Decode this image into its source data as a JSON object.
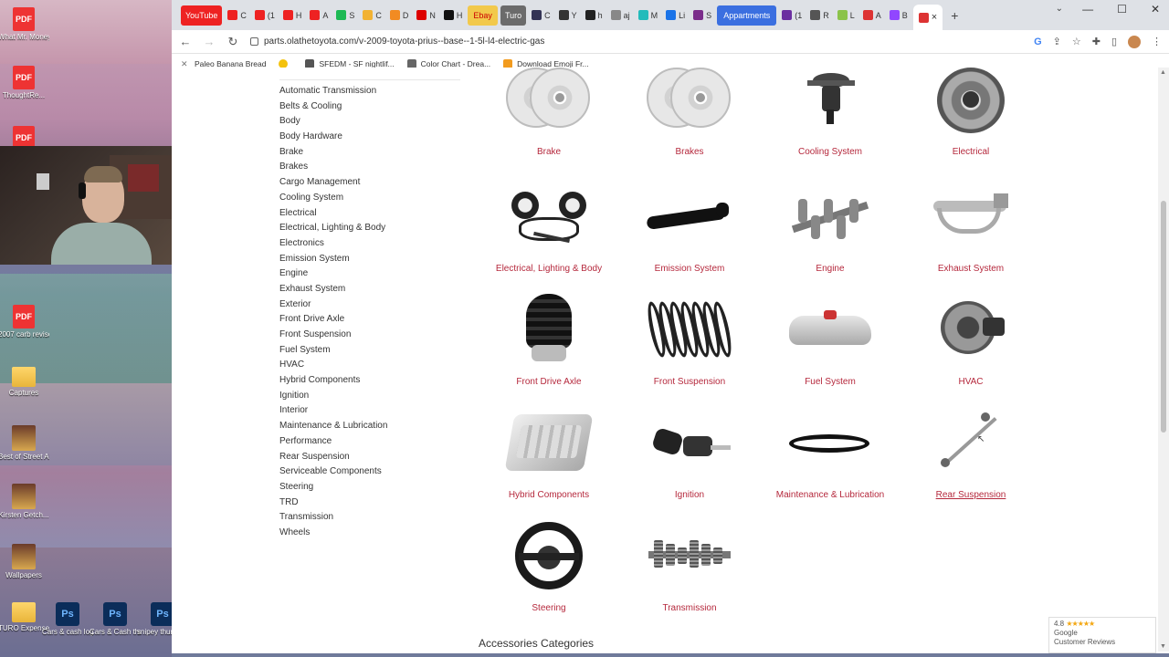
{
  "desktop": {
    "icons": [
      {
        "type": "pdf",
        "badge": "PDF",
        "label": "What Mr. Money - G..."
      },
      {
        "type": "pdf",
        "badge": "PDF",
        "label": "ThoughtRe..."
      },
      {
        "type": "pdf",
        "badge": "PDF",
        "label": ""
      },
      {
        "type": "pdf",
        "badge": "PDF",
        "label": "2007 carb revised ridi..."
      },
      {
        "type": "folder",
        "label": "Captures"
      },
      {
        "type": "image",
        "label": "Best of Street ARSA"
      },
      {
        "type": "image",
        "label": "Kirsten Getch..."
      },
      {
        "type": "image",
        "label": "Wallpapers"
      },
      {
        "type": "folder",
        "label": "TURO Expenses"
      }
    ],
    "ps_files": [
      {
        "badge": "Ps",
        "tag": "PSD",
        "label": "Cars & cash logo.psd"
      },
      {
        "badge": "Ps",
        "tag": "PSD",
        "label": "Cars & Cash thumbnail..."
      },
      {
        "badge": "Ps",
        "tag": "PSD",
        "label": "snipey thumbn..."
      }
    ]
  },
  "browser": {
    "tabs": [
      {
        "label": "YouTube",
        "style": "youtube"
      },
      {
        "label": "C",
        "color": "#e22"
      },
      {
        "label": "(1",
        "color": "#e22"
      },
      {
        "label": "H",
        "color": "#e22"
      },
      {
        "label": "A",
        "color": "#e22"
      },
      {
        "label": "S",
        "color": "#1db954"
      },
      {
        "label": "C",
        "color": "#f2b233"
      },
      {
        "label": "D",
        "color": "#f28b22"
      },
      {
        "label": "N",
        "color": "#d00"
      },
      {
        "label": "H",
        "color": "#111"
      },
      {
        "label": "Ebay",
        "style": "ebay"
      },
      {
        "label": "Turo",
        "style": "turo"
      },
      {
        "label": "C",
        "color": "#335"
      },
      {
        "label": "Y",
        "color": "#333"
      },
      {
        "label": "h",
        "color": "#222"
      },
      {
        "label": "aj",
        "color": "#888"
      },
      {
        "label": "M",
        "color": "#2bb"
      },
      {
        "label": "Li",
        "color": "#1a73e8"
      },
      {
        "label": "S",
        "color": "#7b2d8b"
      },
      {
        "label": "Appartments",
        "style": "appart"
      },
      {
        "label": "(1",
        "color": "#6b2fa0"
      },
      {
        "label": "R",
        "color": "#555"
      },
      {
        "label": "L",
        "color": "#8bc34a"
      },
      {
        "label": "A",
        "color": "#d33"
      },
      {
        "label": "B",
        "color": "#9146ff"
      }
    ],
    "active_tab_close": "×",
    "new_tab": "+",
    "window_controls": {
      "dropdown": "⌄",
      "minimize": "—",
      "maximize": "☐",
      "close": "✕"
    },
    "url": "parts.olathetoyota.com/v-2009-toyota-prius--base--1-5l-l4-electric-gas",
    "bookmarks": [
      {
        "label": "Paleo Banana Bread",
        "color": "#777"
      },
      {
        "label": "",
        "color": "#f4c20d"
      },
      {
        "label": "SFEDM - SF nightlif...",
        "color": "#555"
      },
      {
        "label": "Color Chart - Drea...",
        "color": "#666"
      },
      {
        "label": "Download Emoji Fr...",
        "color": "#f29b1e"
      }
    ]
  },
  "page": {
    "sidebar_categories": [
      "Automatic Transmission",
      "Belts & Cooling",
      "Body",
      "Body Hardware",
      "Brake",
      "Brakes",
      "Cargo Management",
      "Cooling System",
      "Electrical",
      "Electrical, Lighting & Body",
      "Electronics",
      "Emission System",
      "Engine",
      "Exhaust System",
      "Exterior",
      "Front Drive Axle",
      "Front Suspension",
      "Fuel System",
      "HVAC",
      "Hybrid Components",
      "Ignition",
      "Interior",
      "Maintenance & Lubrication",
      "Performance",
      "Rear Suspension",
      "Serviceable Components",
      "Steering",
      "TRD",
      "Transmission",
      "Wheels"
    ],
    "grid_categories": [
      {
        "label": "Brake",
        "art": "disc"
      },
      {
        "label": "Brakes",
        "art": "disc"
      },
      {
        "label": "Cooling System",
        "art": "thermostat"
      },
      {
        "label": "Electrical",
        "art": "alternator"
      },
      {
        "label": "Electrical, Lighting & Body",
        "art": "harness"
      },
      {
        "label": "Emission System",
        "art": "hose"
      },
      {
        "label": "Engine",
        "art": "crankshaft"
      },
      {
        "label": "Exhaust System",
        "art": "manifold"
      },
      {
        "label": "Front Drive Axle",
        "art": "boot"
      },
      {
        "label": "Front Suspension",
        "art": "spring"
      },
      {
        "label": "Fuel System",
        "art": "tank"
      },
      {
        "label": "HVAC",
        "art": "compressor"
      },
      {
        "label": "Hybrid Components",
        "art": "battery"
      },
      {
        "label": "Ignition",
        "art": "key"
      },
      {
        "label": "Maintenance & Lubrication",
        "art": "belt"
      },
      {
        "label": "Rear Suspension",
        "art": "link",
        "hovered": true
      },
      {
        "label": "Steering",
        "art": "wheel"
      },
      {
        "label": "Transmission",
        "art": "gears"
      }
    ],
    "accessories_title": "Accessories Categories"
  },
  "reviews_badge": {
    "rating": "4.8",
    "stars": "★★★★★",
    "source": "Google",
    "label": "Customer Reviews"
  }
}
